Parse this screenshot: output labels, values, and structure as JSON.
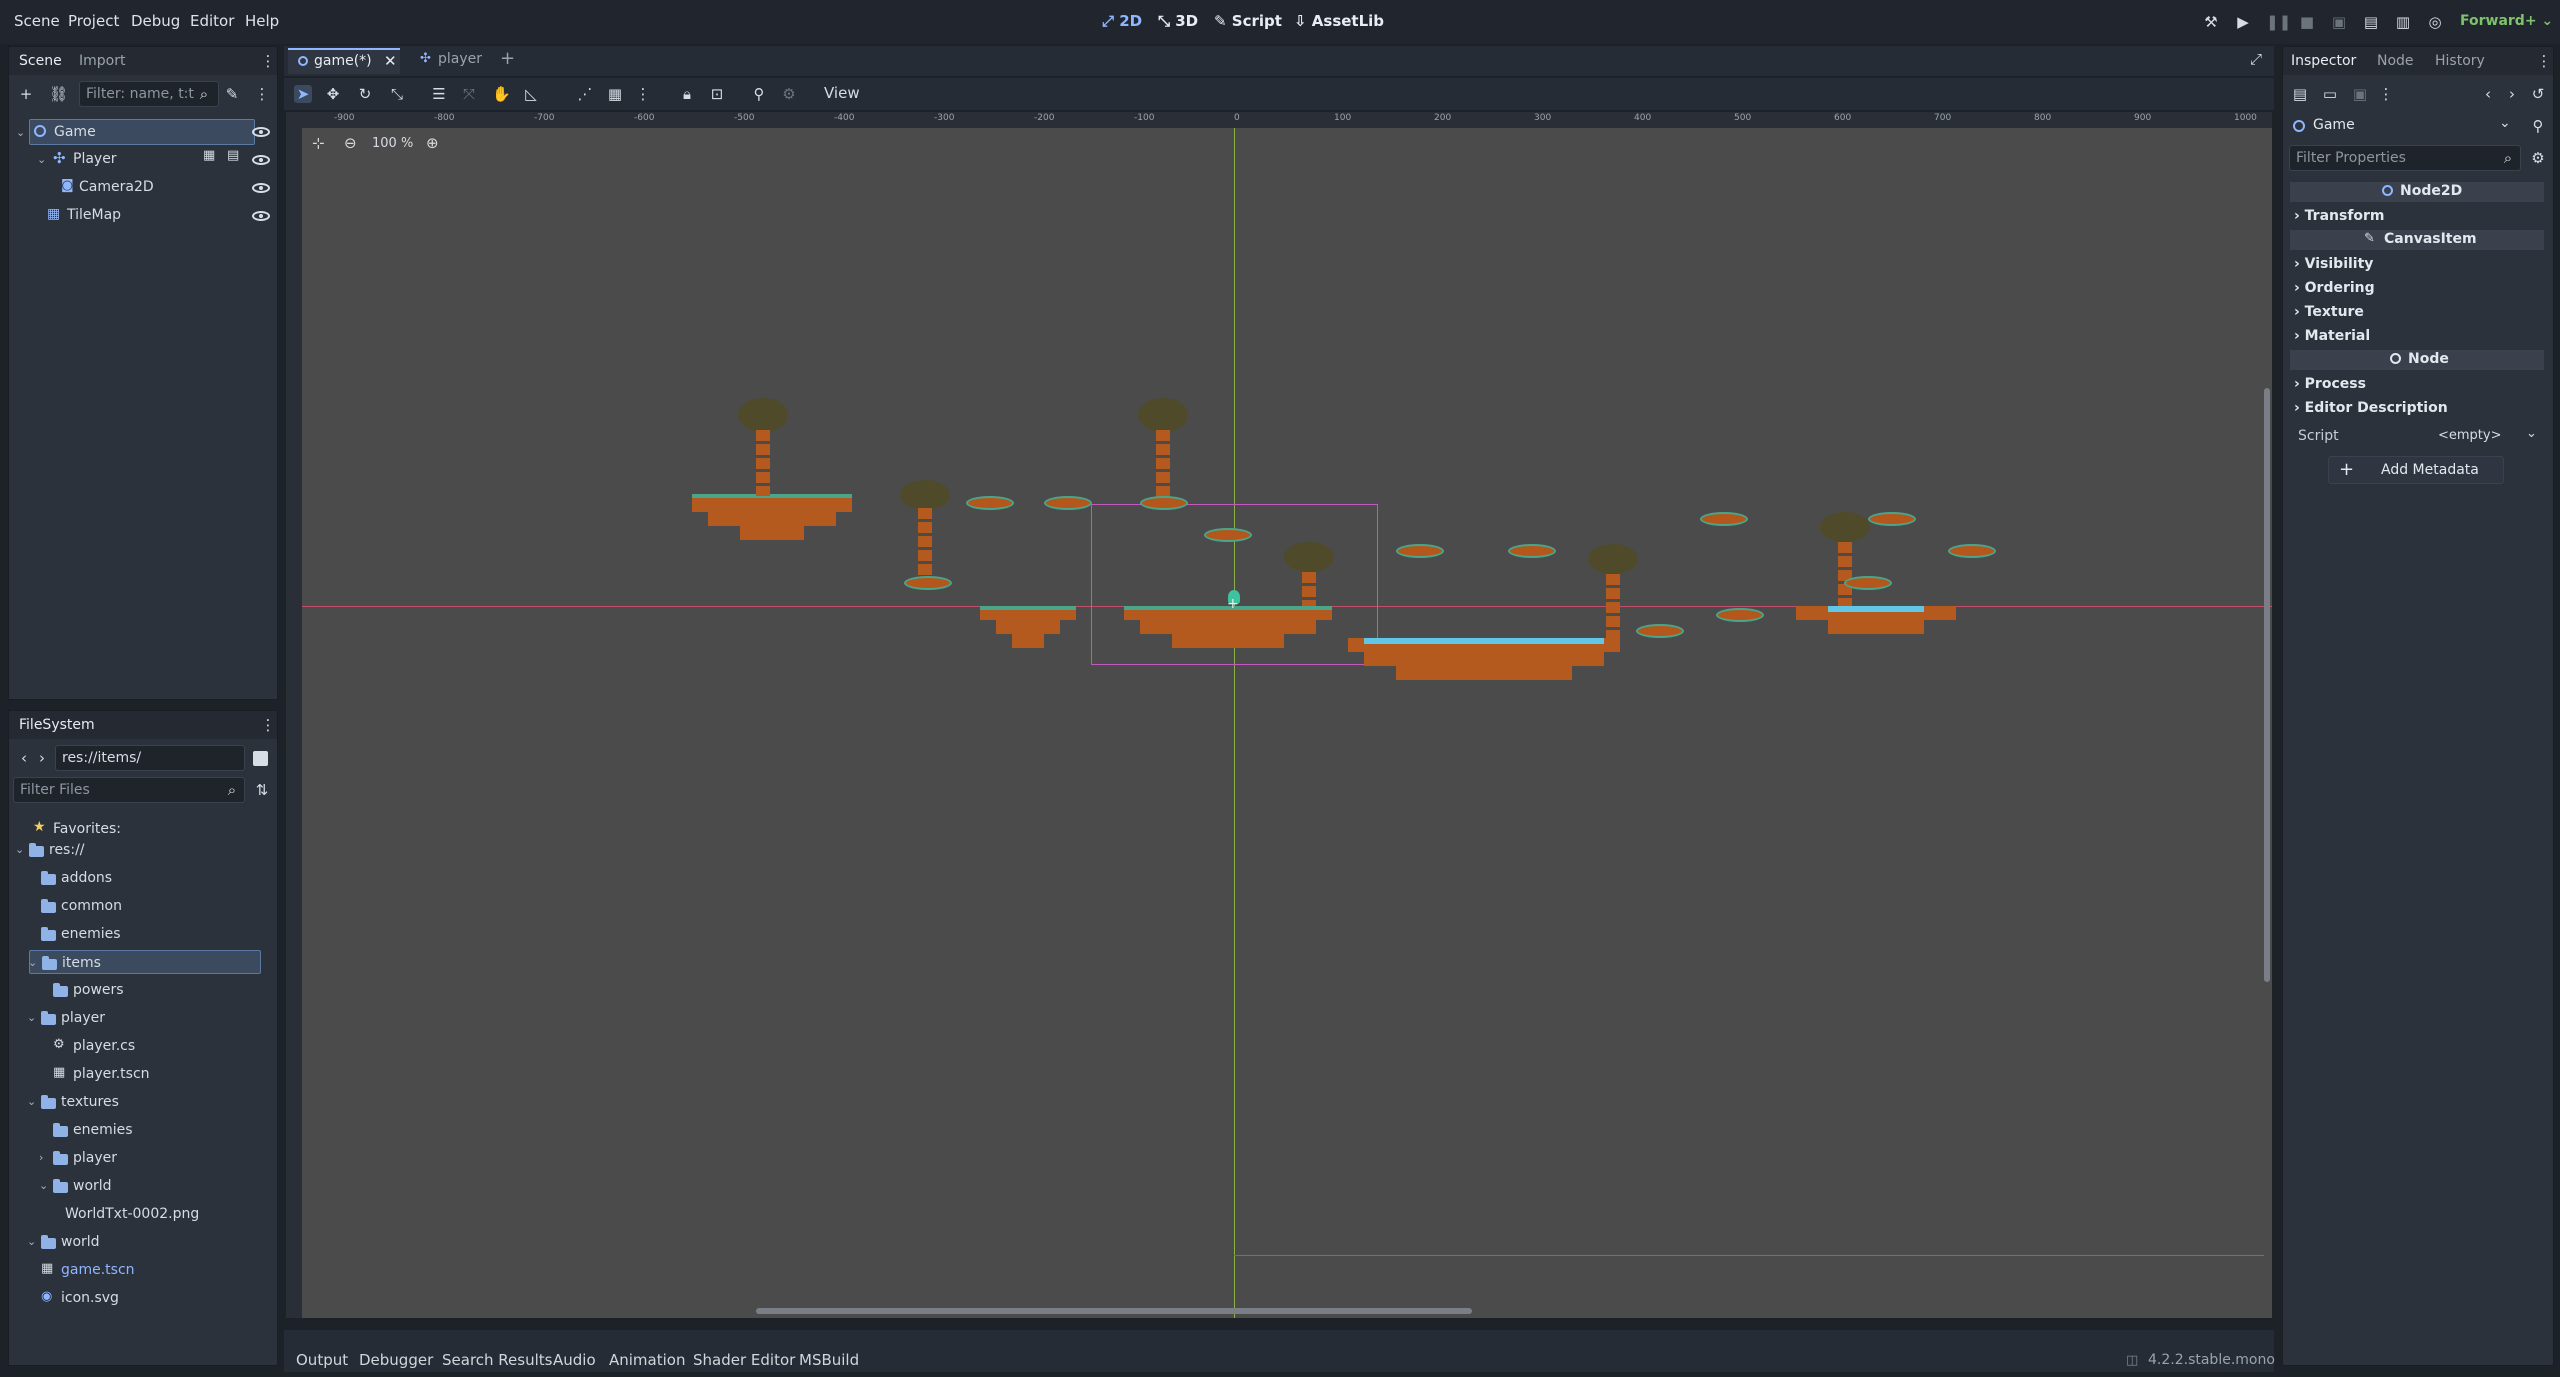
{
  "menubar": {
    "items": [
      "Scene",
      "Project",
      "Debug",
      "Editor",
      "Help"
    ],
    "modes": [
      "2D",
      "3D",
      "Script",
      "AssetLib"
    ],
    "renderer": "Forward+"
  },
  "scene_dock": {
    "tabs": [
      "Scene",
      "Import"
    ],
    "filter_placeholder": "Filter: name, t:t",
    "tree": [
      {
        "label": "Game",
        "icon": "node2d-icon",
        "selected": true
      },
      {
        "label": "Player",
        "icon": "character-icon"
      },
      {
        "label": "Camera2D",
        "icon": "camera-icon"
      },
      {
        "label": "TileMap",
        "icon": "tilemap-icon"
      }
    ]
  },
  "filesystem": {
    "tab": "FileSystem",
    "path": "res://items/",
    "filter_placeholder": "Filter Files",
    "favorites_label": "Favorites:",
    "items": [
      {
        "label": "res://",
        "type": "folder",
        "depth": 0
      },
      {
        "label": "addons",
        "type": "folder",
        "depth": 1
      },
      {
        "label": "common",
        "type": "folder",
        "depth": 1
      },
      {
        "label": "enemies",
        "type": "folder",
        "depth": 1
      },
      {
        "label": "items",
        "type": "folder",
        "depth": 1,
        "selected": true
      },
      {
        "label": "powers",
        "type": "folder",
        "depth": 2
      },
      {
        "label": "player",
        "type": "folder",
        "depth": 1
      },
      {
        "label": "player.cs",
        "type": "script",
        "depth": 2
      },
      {
        "label": "player.tscn",
        "type": "scene",
        "depth": 2
      },
      {
        "label": "textures",
        "type": "folder",
        "depth": 1
      },
      {
        "label": "enemies",
        "type": "folder",
        "depth": 2
      },
      {
        "label": "player",
        "type": "folder",
        "depth": 2
      },
      {
        "label": "world",
        "type": "folder",
        "depth": 2
      },
      {
        "label": "WorldTxt-0002.png",
        "type": "image",
        "depth": 3
      },
      {
        "label": "world",
        "type": "folder",
        "depth": 1
      },
      {
        "label": "game.tscn",
        "type": "scene",
        "depth": 1
      },
      {
        "label": "icon.svg",
        "type": "svg",
        "depth": 1
      }
    ]
  },
  "editor_tabs": [
    "game(*)",
    "player"
  ],
  "toolbar": {
    "view_label": "View",
    "zoom": "100 %"
  },
  "ruler_labels": [
    "-900",
    "-800",
    "-700",
    "-600",
    "-500",
    "-400",
    "-300",
    "-200",
    "-100",
    "0",
    "100",
    "200",
    "300",
    "400",
    "500",
    "600",
    "700",
    "800",
    "900",
    "1000"
  ],
  "inspector": {
    "tabs": [
      "Inspector",
      "Node",
      "History"
    ],
    "node_name": "Game",
    "filter_placeholder": "Filter Properties",
    "categories": [
      {
        "title": "Node2D",
        "sections": [
          "Transform"
        ]
      },
      {
        "title": "CanvasItem",
        "sections": [
          "Visibility",
          "Ordering",
          "Texture",
          "Material"
        ]
      },
      {
        "title": "Node",
        "sections": [
          "Process",
          "Editor Description"
        ]
      }
    ],
    "script_label": "Script",
    "script_value": "<empty>",
    "add_metadata": "Add Metadata"
  },
  "bottom_panel": {
    "tabs": [
      "Output",
      "Debugger",
      "Search Results",
      "Audio",
      "Animation",
      "Shader Editor",
      "MSBuild"
    ],
    "version": "4.2.2.stable.mono"
  },
  "colors": {
    "accent": "#8fb6ff",
    "dirt": "#b45a1f",
    "grass": "#4aa58a",
    "water": "#62c7e6",
    "selection": "#c058c0"
  }
}
